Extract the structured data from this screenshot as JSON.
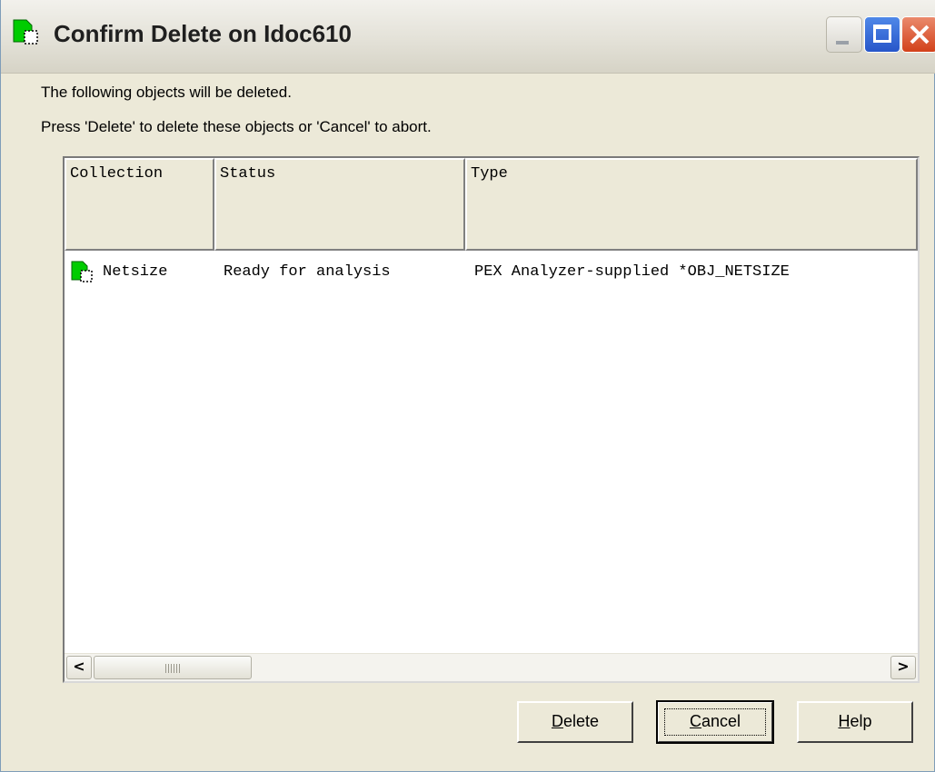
{
  "window": {
    "title": "Confirm Delete on Idoc610"
  },
  "message": {
    "line1": "The following objects will be deleted.",
    "line2": "Press 'Delete' to delete these objects or 'Cancel' to abort."
  },
  "table": {
    "columns": [
      "Collection",
      "Status",
      "Type"
    ],
    "rows": [
      {
        "icon": "collection-icon",
        "collection": "Netsize",
        "status": "Ready for analysis",
        "type": "PEX Analyzer-supplied *OBJ_NETSIZE"
      }
    ]
  },
  "scrollbar": {
    "left_arrow": "<",
    "right_arrow": ">"
  },
  "buttons": {
    "delete": {
      "mnemonic": "D",
      "rest": "elete"
    },
    "cancel": {
      "mnemonic": "C",
      "rest": "ancel"
    },
    "help": {
      "mnemonic": "H",
      "rest": "elp"
    }
  },
  "colors": {
    "icon_green": "#00cc00",
    "title_close": "#d2411a",
    "title_max": "#2756c9"
  }
}
